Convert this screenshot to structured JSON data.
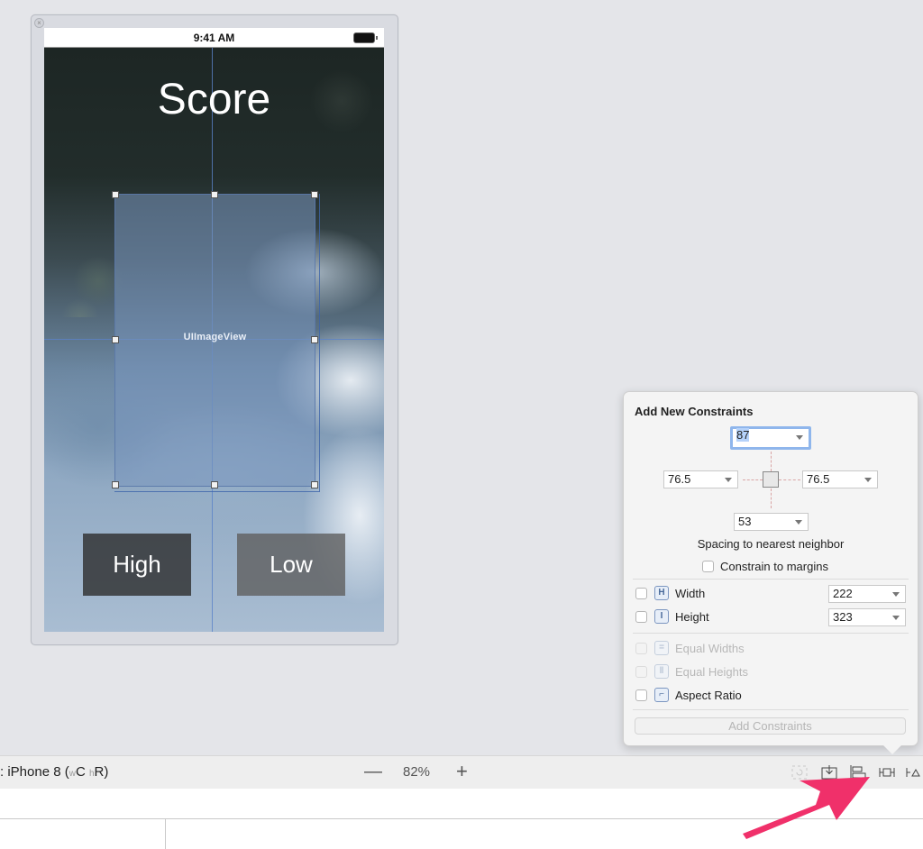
{
  "scene": {
    "status_time": "9:41 AM",
    "title_label": "Score",
    "image_view_label": "UIImageView",
    "buttons": [
      {
        "label": "High"
      },
      {
        "label": "Low"
      }
    ]
  },
  "bottom_bar": {
    "device_prefix": ": iPhone 8 (",
    "size_class_w_prefix": "w",
    "size_class_w": "C",
    "size_class_h_prefix": "h",
    "size_class_h": "R)",
    "zoom_out_icon": "minus-icon",
    "zoom_value": "82%",
    "zoom_in_icon": "plus-icon",
    "tools": [
      {
        "icon": "update-frames-icon",
        "enabled": false
      },
      {
        "icon": "embed-in-icon",
        "enabled": true
      },
      {
        "icon": "align-icon",
        "enabled": true
      },
      {
        "icon": "add-new-constraints-icon",
        "enabled": true
      },
      {
        "icon": "resolve-auto-layout-issues-icon",
        "enabled": true
      }
    ]
  },
  "popover": {
    "title": "Add New Constraints",
    "spacing": {
      "top": "87",
      "left": "76.5",
      "right": "76.5",
      "bottom": "53"
    },
    "spacing_label": "Spacing to nearest neighbor",
    "constrain_to_margins": {
      "label": "Constrain to margins",
      "checked": false
    },
    "rows": [
      {
        "label": "Width",
        "checked": false,
        "enabled": true,
        "value": "222",
        "icon": "width-icon"
      },
      {
        "label": "Height",
        "checked": false,
        "enabled": true,
        "value": "323",
        "icon": "height-icon"
      },
      {
        "label": "Equal Widths",
        "checked": false,
        "enabled": false,
        "icon": "equal-widths-icon"
      },
      {
        "label": "Equal Heights",
        "checked": false,
        "enabled": false,
        "icon": "equal-heights-icon"
      },
      {
        "label": "Aspect Ratio",
        "checked": false,
        "enabled": true,
        "icon": "aspect-ratio-icon"
      }
    ],
    "add_button": "Add Constraints"
  },
  "annotation": {
    "arrow_color": "#f0306a"
  }
}
